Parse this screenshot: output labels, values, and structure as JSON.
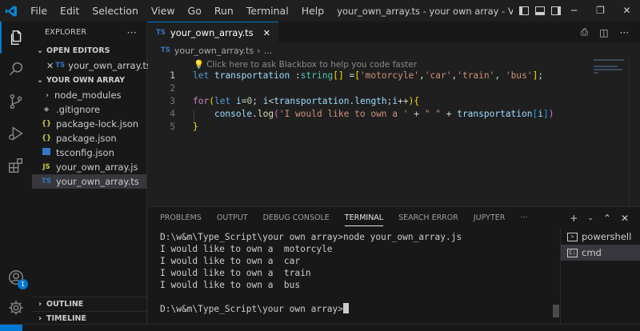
{
  "titlebar": {
    "menu": [
      "File",
      "Edit",
      "Selection",
      "View",
      "Go",
      "Run",
      "Terminal",
      "Help"
    ],
    "title": "your_own_array.ts - your own array - Visual Studio Code [Admin..."
  },
  "activitybar": {
    "icons": [
      "files-icon",
      "search-icon",
      "source-control-icon",
      "run-debug-icon",
      "extensions-icon",
      "accounts-icon",
      "settings-icon"
    ],
    "accounts_badge": "1"
  },
  "sidebar": {
    "header": "EXPLORER",
    "open_editors_label": "OPEN EDITORS",
    "open_editors": [
      {
        "type": "TS",
        "name": "your_own_array.ts"
      }
    ],
    "folder_label": "YOUR OWN ARRAY",
    "files": [
      {
        "type": "folder",
        "name": "node_modules"
      },
      {
        "type": "git",
        "name": ".gitignore"
      },
      {
        "type": "json",
        "name": "package-lock.json"
      },
      {
        "type": "json",
        "name": "package.json"
      },
      {
        "type": "TS",
        "name": "tsconfig.json"
      },
      {
        "type": "JS",
        "name": "your_own_array.js"
      },
      {
        "type": "TS",
        "name": "your_own_array.ts"
      }
    ],
    "outline_label": "OUTLINE",
    "timeline_label": "TIMELINE"
  },
  "editor": {
    "tab_label": "your_own_array.ts",
    "breadcrumb_file": "your_own_array.ts",
    "breadcrumb_more": "...",
    "hint": "Click here to ask Blackbox to help you code faster",
    "line_numbers": [
      "1",
      "2",
      "3",
      "4",
      "5"
    ],
    "lines": [
      "let transportation :string[] =['motorcyle','car','train', 'bus'];",
      "",
      "for(let i=0; i<transportation.length;i++){",
      "    console.log('I would like to own a ' + \" \" + transportation[i])",
      "}"
    ]
  },
  "panel": {
    "tabs": [
      "PROBLEMS",
      "OUTPUT",
      "DEBUG CONSOLE",
      "TERMINAL",
      "SEARCH ERROR",
      "JUPYTER"
    ],
    "active_tab": "TERMINAL",
    "terminal_lines": [
      "D:\\w&m\\Type_Script\\your own array>node your_own_array.js",
      "I would like to own a  motorcyle",
      "I would like to own a  car",
      "I would like to own a  train",
      "I would like to own a  bus",
      "",
      "D:\\w&m\\Type_Script\\your own array>"
    ],
    "terminals": [
      "powershell",
      "cmd"
    ],
    "selected_terminal": "cmd"
  },
  "colors": {
    "accent": "#0078d4",
    "ts_icon": "#3178c6",
    "js_icon": "#cbcb41"
  }
}
